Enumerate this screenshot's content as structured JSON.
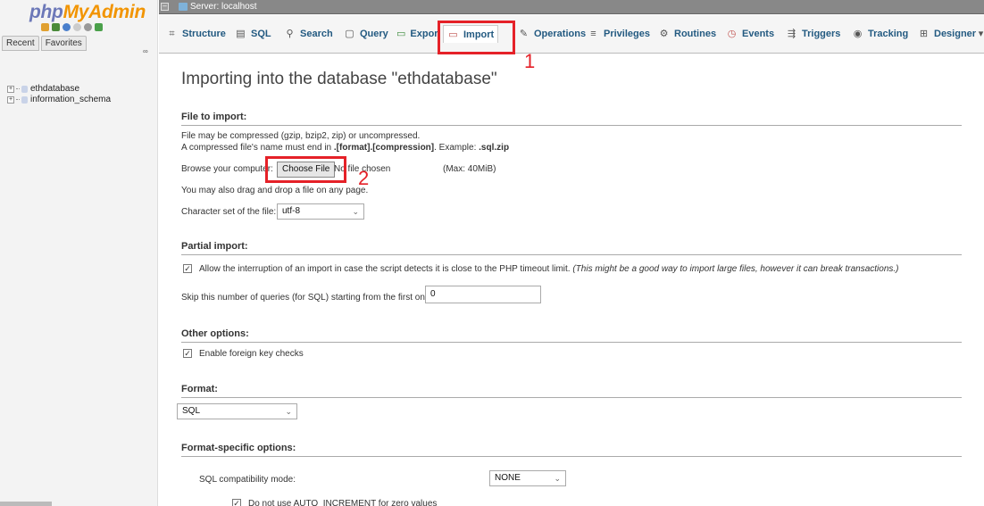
{
  "sidebar": {
    "logo_part1": "php",
    "logo_part2": "MyAdmin",
    "tabs": [
      "Recent",
      "Favorites"
    ],
    "tree": [
      {
        "label": "ethdatabase"
      },
      {
        "label": "information_schema"
      }
    ]
  },
  "topbar": {
    "server_label": "Server: localhost"
  },
  "tabs": [
    {
      "label": "Structure",
      "icon": "structure-icon"
    },
    {
      "label": "SQL",
      "icon": "sql-icon"
    },
    {
      "label": "Search",
      "icon": "search-icon"
    },
    {
      "label": "Query",
      "icon": "query-icon"
    },
    {
      "label": "Export",
      "icon": "export-icon"
    },
    {
      "label": "Import",
      "icon": "import-icon"
    },
    {
      "label": "Operations",
      "icon": "operations-icon"
    },
    {
      "label": "Privileges",
      "icon": "privileges-icon"
    },
    {
      "label": "Routines",
      "icon": "routines-icon"
    },
    {
      "label": "Events",
      "icon": "events-icon"
    },
    {
      "label": "Triggers",
      "icon": "triggers-icon"
    },
    {
      "label": "Tracking",
      "icon": "tracking-icon"
    },
    {
      "label": "Designer",
      "icon": "designer-icon"
    }
  ],
  "annotations": {
    "one": "1",
    "two": "2"
  },
  "main": {
    "title": "Importing into the database \"ethdatabase\"",
    "file_section": {
      "heading": "File to import:",
      "line1": "File may be compressed (gzip, bzip2, zip) or uncompressed.",
      "line2_prefix": "A compressed file's name must end in ",
      "line2_format": ".[format].[compression]",
      "line2_mid": ". Example: ",
      "line2_example": ".sql.zip",
      "browse_label": "Browse your computer:",
      "choose_button": "Choose File",
      "no_file": "No file chosen",
      "max_size": "(Max: 40MiB)",
      "drag_hint": "You may also drag and drop a file on any page.",
      "charset_label": "Character set of the file:",
      "charset_value": "utf-8"
    },
    "partial_section": {
      "heading": "Partial import:",
      "allow_interrupt": "Allow the interruption of an import in case the script detects it is close to the PHP timeout limit.",
      "allow_interrupt_note": "(This might be a good way to import large files, however it can break transactions.)",
      "skip_label": "Skip this number of queries (for SQL) starting from the first one:",
      "skip_value": "0"
    },
    "other_section": {
      "heading": "Other options:",
      "foreign_key": "Enable foreign key checks"
    },
    "format_section": {
      "heading": "Format:",
      "format_value": "SQL"
    },
    "format_specific": {
      "heading": "Format-specific options:",
      "compat_label": "SQL compatibility mode:",
      "compat_value": "NONE",
      "auto_inc": "Do not use AUTO_INCREMENT for zero values"
    }
  }
}
